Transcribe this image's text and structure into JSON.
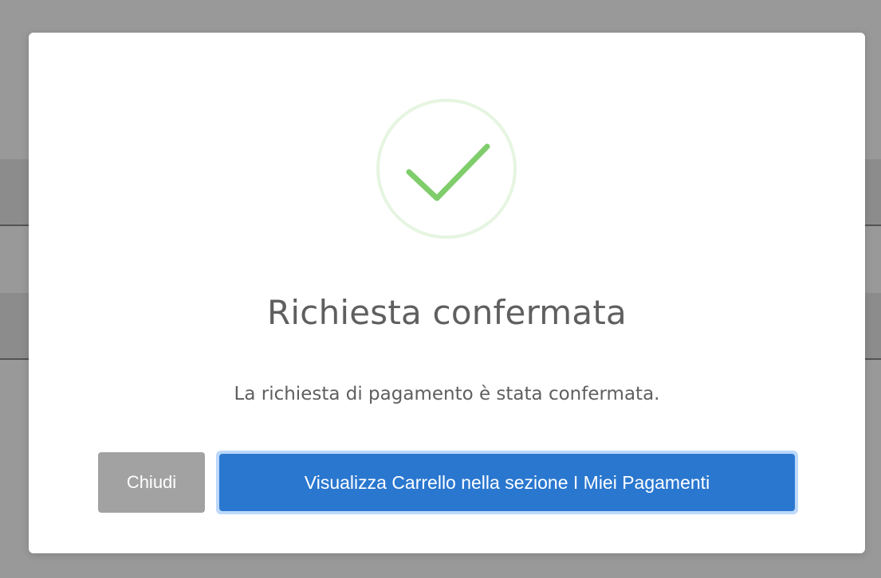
{
  "modal": {
    "icon": "check-circle-icon",
    "title": "Richiesta confermata",
    "message": "La richiesta di pagamento è stata confermata.",
    "buttons": {
      "close_label": "Chiudi",
      "primary_label": "Visualizza Carrello nella sezione I Miei Pagamenti"
    }
  },
  "colors": {
    "success": "#7fcd6b",
    "success_ring": "#e6f5e1",
    "primary": "#2a77cf",
    "secondary": "#a2a2a2",
    "text": "#5f5f5f",
    "overlay": "rgba(0,0,0,0.40)"
  }
}
